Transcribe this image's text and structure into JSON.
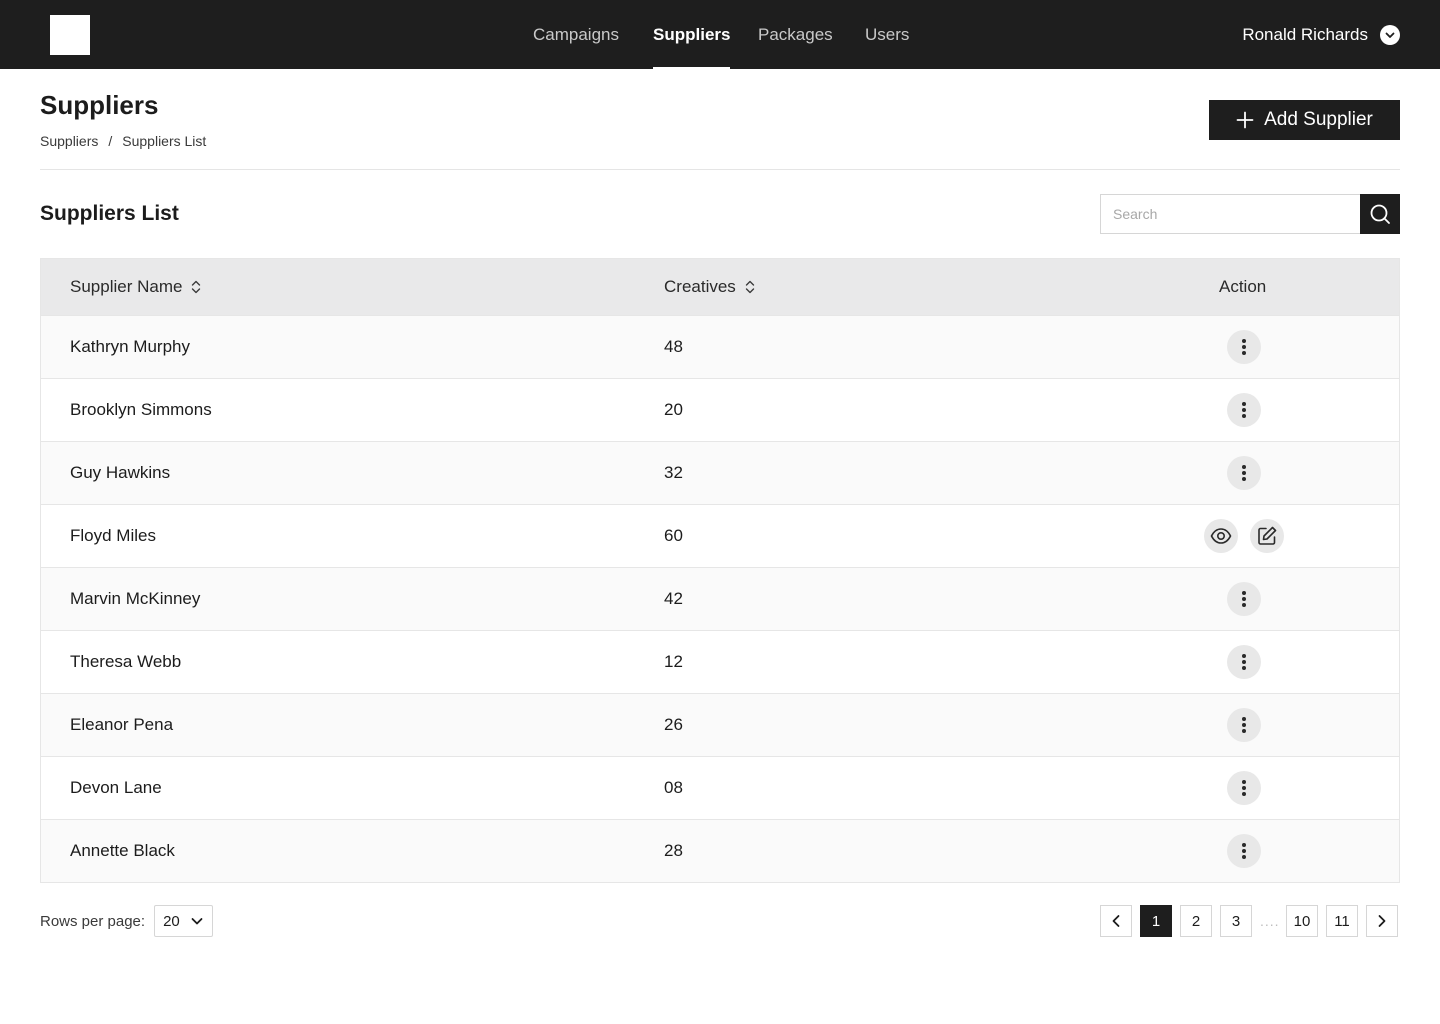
{
  "nav": {
    "items": [
      {
        "label": "Campaigns",
        "active": false
      },
      {
        "label": "Suppliers",
        "active": true
      },
      {
        "label": "Packages",
        "active": false
      },
      {
        "label": "Users",
        "active": false
      }
    ],
    "user_name": "Ronald Richards"
  },
  "header": {
    "title": "Suppliers",
    "breadcrumb": [
      "Suppliers",
      "Suppliers List"
    ],
    "breadcrumb_separator": "/",
    "add_button_label": "Add Supplier"
  },
  "list": {
    "title": "Suppliers List",
    "search_placeholder": "Search",
    "columns": [
      "Supplier Name",
      "Creatives",
      "Action"
    ],
    "rows": [
      {
        "name": "Kathryn Murphy",
        "creatives": "48",
        "expanded": false
      },
      {
        "name": "Brooklyn Simmons",
        "creatives": "20",
        "expanded": false
      },
      {
        "name": "Guy Hawkins",
        "creatives": "32",
        "expanded": false
      },
      {
        "name": "Floyd Miles",
        "creatives": "60",
        "expanded": true
      },
      {
        "name": "Marvin McKinney",
        "creatives": "42",
        "expanded": false
      },
      {
        "name": "Theresa Webb",
        "creatives": "12",
        "expanded": false
      },
      {
        "name": "Eleanor Pena",
        "creatives": "26",
        "expanded": false
      },
      {
        "name": "Devon Lane",
        "creatives": "08",
        "expanded": false
      },
      {
        "name": "Annette Black",
        "creatives": "28",
        "expanded": false
      }
    ]
  },
  "footer": {
    "rows_per_page_label": "Rows per page:",
    "rows_per_page_value": "20",
    "pages": [
      "1",
      "2",
      "3",
      "10",
      "11"
    ],
    "current_page": "1",
    "ellipsis": "...."
  },
  "colors": {
    "nav_bg": "#1e1e1e",
    "header_row_bg": "#e9e9ea",
    "action_button_bg": "#e8e8e8"
  }
}
